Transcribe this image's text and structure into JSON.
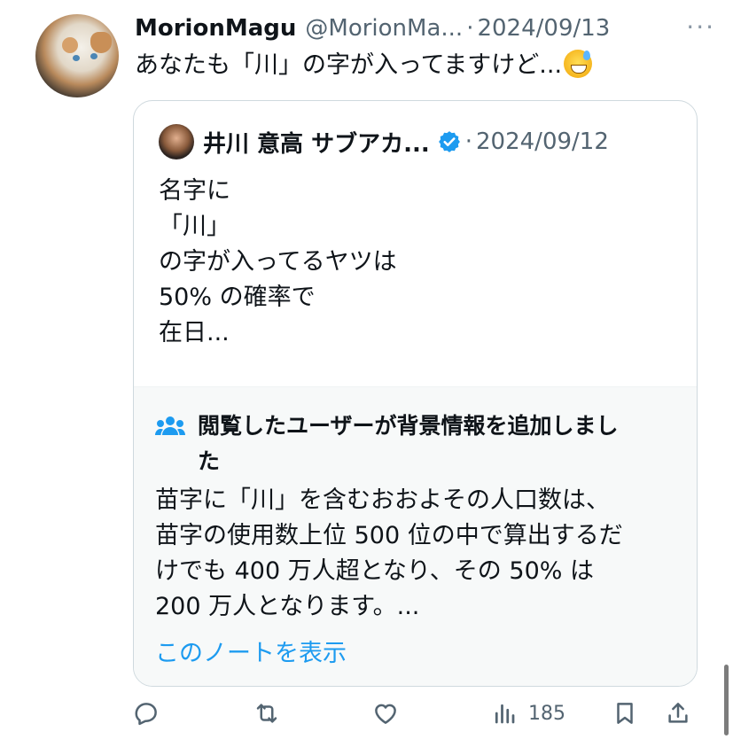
{
  "tweet": {
    "display_name": "MorionMagu",
    "handle": "@MorionMa...",
    "separator": "·",
    "date": "2024/09/13",
    "more": "···",
    "text": "あなたも「川」の字が入ってますけど..."
  },
  "quote": {
    "display_name": "井川 意高 サブアカ...",
    "separator": "·",
    "date": "2024/09/12",
    "lines": [
      "名字に",
      "「川」",
      "の字が入ってるヤツは",
      "50% の確率で",
      "在日..."
    ]
  },
  "community_note": {
    "title_lines": [
      "閲覧したユーザーが背景情報を追加しまし",
      "た"
    ],
    "text_lines": [
      "苗字に「川」を含むおおよその人口数は、",
      "苗字の使用数上位 500 位の中で算出するだ",
      "けでも 400 万人超となり、その 50% は",
      "200 万人となります。..."
    ],
    "link": "このノートを表示"
  },
  "actions": {
    "views": "185"
  },
  "icons": {
    "reply": "reply-icon",
    "retweet": "retweet-icon",
    "like": "heart-icon",
    "views": "views-icon",
    "bookmark": "bookmark-icon",
    "share": "share-icon",
    "verified": "verified-badge-icon",
    "note": "community-notes-icon",
    "emoji": "grinning-sweat-emoji"
  },
  "colors": {
    "link": "#1d9bf0",
    "secondary_text": "#536471",
    "verified": "#1d9bf0"
  }
}
